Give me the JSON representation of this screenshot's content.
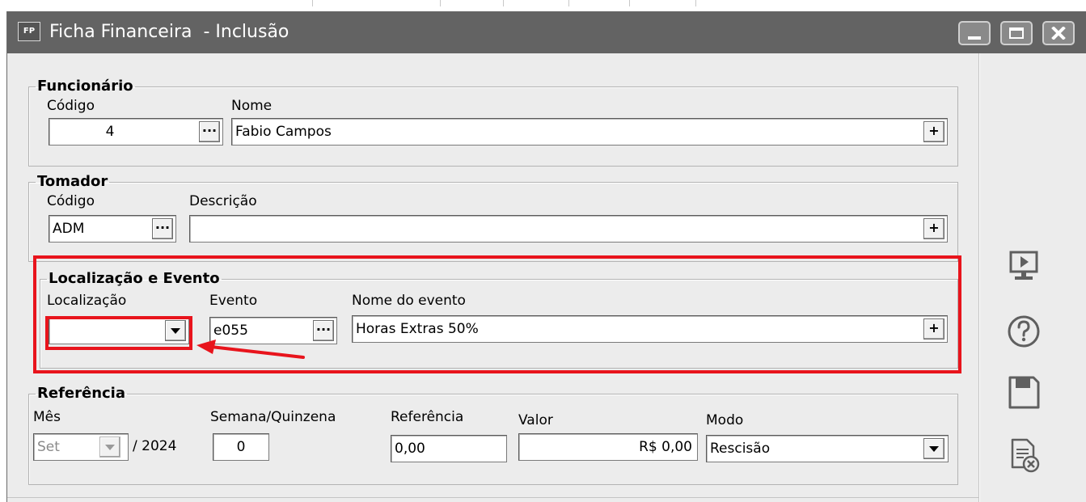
{
  "window": {
    "app_icon": "FP",
    "title": "Ficha Financeira  - Inclusão"
  },
  "funcionario": {
    "legend": "Funcionário",
    "codigo_label": "Código",
    "codigo_value": "4",
    "nome_label": "Nome",
    "nome_value": "Fabio Campos"
  },
  "tomador": {
    "legend": "Tomador",
    "codigo_label": "Código",
    "codigo_value": "ADM",
    "descricao_label": "Descrição",
    "descricao_value": ""
  },
  "localizacao_evento": {
    "legend": "Localização e Evento",
    "localizacao_label": "Localização",
    "localizacao_value": "",
    "evento_label": "Evento",
    "evento_value": "e055",
    "nome_evento_label": "Nome do evento",
    "nome_evento_value": "Horas Extras 50%"
  },
  "referencia": {
    "legend": "Referência",
    "mes_label": "Mês",
    "mes_value": "Set",
    "ano_text": "/ 2024",
    "semana_label": "Semana/Quinzena",
    "semana_value": "0",
    "referencia_label": "Referência",
    "referencia_value": "0,00",
    "valor_label": "Valor",
    "valor_value": "R$ 0,00",
    "modo_label": "Modo",
    "modo_value": "Rescisão"
  },
  "buttons": {
    "ellipsis": "···",
    "plus": "+"
  },
  "sidebar": {
    "icons": [
      "presentation-icon",
      "help-icon",
      "save-icon",
      "cancel-document-icon"
    ]
  },
  "colors": {
    "titlebar": "#636363",
    "highlight": "#e8141c",
    "window_bg": "#ececec"
  }
}
